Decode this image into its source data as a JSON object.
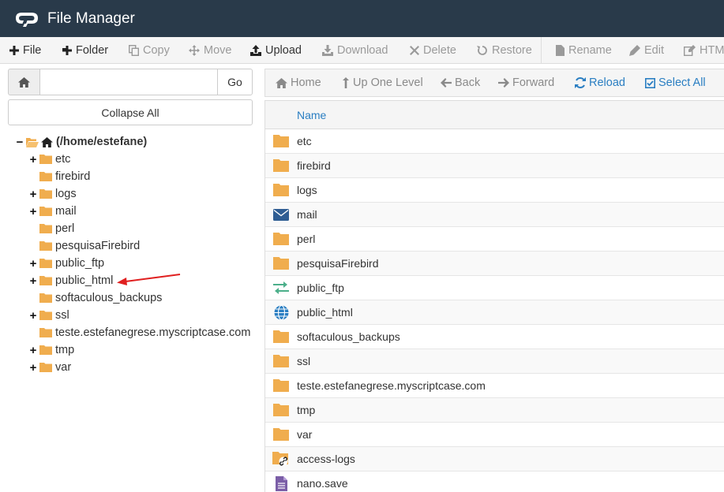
{
  "header": {
    "title": "File Manager"
  },
  "toolbar": {
    "items": [
      {
        "label": "File",
        "enabled": true
      },
      {
        "label": "Folder",
        "enabled": true
      },
      {
        "label": "Copy",
        "enabled": false
      },
      {
        "label": "Move",
        "enabled": false
      },
      {
        "label": "Upload",
        "enabled": true
      },
      {
        "label": "Download",
        "enabled": false
      },
      {
        "label": "Delete",
        "enabled": false
      },
      {
        "label": "Restore",
        "enabled": false
      },
      {
        "label": "Rename",
        "enabled": false
      },
      {
        "label": "Edit",
        "enabled": false
      },
      {
        "label": "HTM",
        "enabled": false
      }
    ]
  },
  "search": {
    "go_label": "Go",
    "value": ""
  },
  "sidebar": {
    "collapse_label": "Collapse All",
    "root_label": "(/home/estefane)",
    "tree": [
      {
        "label": "etc",
        "expandable": true
      },
      {
        "label": "firebird",
        "expandable": false
      },
      {
        "label": "logs",
        "expandable": true
      },
      {
        "label": "mail",
        "expandable": true
      },
      {
        "label": "perl",
        "expandable": false
      },
      {
        "label": "pesquisaFirebird",
        "expandable": false
      },
      {
        "label": "public_ftp",
        "expandable": true
      },
      {
        "label": "public_html",
        "expandable": true
      },
      {
        "label": "softaculous_backups",
        "expandable": false
      },
      {
        "label": "ssl",
        "expandable": true
      },
      {
        "label": "teste.estefanegrese.myscriptcase.com",
        "expandable": false
      },
      {
        "label": "tmp",
        "expandable": true
      },
      {
        "label": "var",
        "expandable": true
      }
    ]
  },
  "nav": {
    "home": "Home",
    "up": "Up One Level",
    "back": "Back",
    "forward": "Forward",
    "reload": "Reload",
    "select_all": "Select All"
  },
  "table": {
    "header_name": "Name",
    "rows": [
      {
        "name": "etc",
        "icon": "folder-icon"
      },
      {
        "name": "firebird",
        "icon": "folder-icon"
      },
      {
        "name": "logs",
        "icon": "folder-icon"
      },
      {
        "name": "mail",
        "icon": "mail-icon"
      },
      {
        "name": "perl",
        "icon": "folder-icon"
      },
      {
        "name": "pesquisaFirebird",
        "icon": "folder-icon"
      },
      {
        "name": "public_ftp",
        "icon": "transfer-icon"
      },
      {
        "name": "public_html",
        "icon": "globe-icon"
      },
      {
        "name": "softaculous_backups",
        "icon": "folder-icon"
      },
      {
        "name": "ssl",
        "icon": "folder-icon"
      },
      {
        "name": "teste.estefanegrese.myscriptcase.com",
        "icon": "folder-icon"
      },
      {
        "name": "tmp",
        "icon": "folder-icon"
      },
      {
        "name": "var",
        "icon": "folder-icon"
      },
      {
        "name": "access-logs",
        "icon": "folder-link-icon"
      },
      {
        "name": "nano.save",
        "icon": "text-file-icon"
      }
    ]
  },
  "colors": {
    "header_bg": "#293a4a",
    "link_blue": "#2a7ec2",
    "folder": "#f0ad4e",
    "arrow": "#e02020"
  }
}
